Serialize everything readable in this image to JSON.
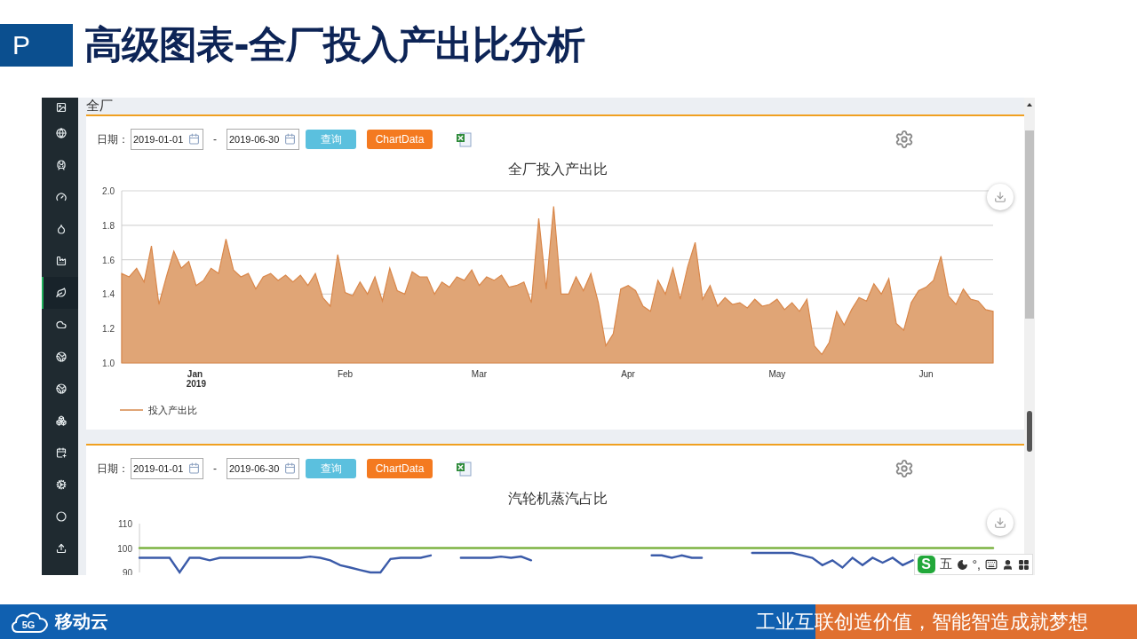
{
  "slide": {
    "badge": "P",
    "title": "高级图表-全厂投入产出比分析"
  },
  "app": {
    "breadcrumb": "全厂",
    "sidebar": {
      "items": [
        {
          "selected": false
        },
        {
          "selected": false
        },
        {
          "selected": false
        },
        {
          "selected": false
        },
        {
          "selected": false
        },
        {
          "selected": false
        },
        {
          "selected": true
        },
        {
          "selected": false
        },
        {
          "selected": false
        },
        {
          "selected": false
        },
        {
          "selected": false
        },
        {
          "selected": false
        },
        {
          "selected": false
        },
        {
          "selected": false
        },
        {
          "selected": false
        }
      ]
    },
    "panels": [
      {
        "date_label": "日期：",
        "start_date": "2019-01-01",
        "separator": "-",
        "end_date": "2019-06-30",
        "buttons": [
          {
            "label": "查询",
            "kind": "query"
          },
          {
            "label": "ChartData",
            "kind": "data"
          }
        ],
        "chart_data": {
          "type": "area",
          "title": "全厂投入产出比",
          "ylim": [
            1,
            2
          ],
          "grid": true,
          "categories": [
            null,
            null,
            null,
            null,
            null,
            null,
            null,
            null,
            null,
            null,
            "Jan 2019",
            null,
            null,
            null,
            null,
            null,
            null,
            null,
            null,
            null,
            null,
            null,
            null,
            null,
            null,
            null,
            null,
            null,
            null,
            null,
            "Feb",
            null,
            null,
            null,
            null,
            null,
            null,
            null,
            null,
            null,
            null,
            null,
            null,
            null,
            null,
            null,
            null,
            null,
            "Mar",
            null,
            null,
            null,
            null,
            null,
            null,
            null,
            null,
            null,
            null,
            null,
            null,
            null,
            null,
            null,
            null,
            null,
            null,
            null,
            "Apr",
            null,
            null,
            null,
            null,
            null,
            null,
            null,
            null,
            null,
            null,
            null,
            null,
            null,
            null,
            null,
            null,
            null,
            null,
            null,
            "May",
            null,
            null,
            null,
            null,
            null,
            null,
            null,
            null,
            null,
            null,
            null,
            null,
            null,
            null,
            null,
            null,
            null,
            null,
            null,
            "Jun",
            null,
            null,
            null,
            null,
            null,
            null,
            null,
            null,
            null
          ],
          "yticks": [
            {
              "value": 1,
              "label": "1.0"
            },
            {
              "value": 1.2,
              "label": "1.2"
            },
            {
              "value": 1.4,
              "label": "1.4"
            },
            {
              "value": 1.6,
              "label": "1.6"
            },
            {
              "value": 1.8,
              "label": "1.8"
            },
            {
              "value": 2,
              "label": "2.0"
            }
          ],
          "series": [
            {
              "name": "投入产出比",
              "color": "#e0a576",
              "values": [
                1.52,
                1.5,
                1.55,
                1.47,
                1.68,
                1.34,
                1.5,
                1.65,
                1.55,
                1.59,
                1.45,
                1.48,
                1.55,
                1.52,
                1.72,
                1.54,
                1.5,
                1.52,
                1.43,
                1.5,
                1.52,
                1.48,
                1.51,
                1.47,
                1.51,
                1.45,
                1.52,
                1.38,
                1.33,
                1.63,
                1.41,
                1.39,
                1.47,
                1.4,
                1.5,
                1.36,
                1.55,
                1.42,
                1.4,
                1.53,
                1.5,
                1.5,
                1.4,
                1.47,
                1.44,
                1.5,
                1.48,
                1.54,
                1.45,
                1.5,
                1.48,
                1.51,
                1.44,
                1.45,
                1.47,
                1.35,
                1.84,
                1.43,
                1.91,
                1.4,
                1.4,
                1.5,
                1.42,
                1.52,
                1.35,
                1.1,
                1.17,
                1.43,
                1.45,
                1.42,
                1.33,
                1.3,
                1.48,
                1.4,
                1.55,
                1.37,
                1.56,
                1.7,
                1.37,
                1.45,
                1.33,
                1.38,
                1.34,
                1.35,
                1.32,
                1.37,
                1.33,
                1.34,
                1.37,
                1.31,
                1.35,
                1.3,
                1.37,
                1.1,
                1.05,
                1.12,
                1.3,
                1.22,
                1.31,
                1.38,
                1.36,
                1.46,
                1.4,
                1.49,
                1.23,
                1.19,
                1.35,
                1.42,
                1.44,
                1.48,
                1.62,
                1.39,
                1.34,
                1.43,
                1.37,
                1.36,
                1.31,
                1.3
              ]
            }
          ]
        }
      },
      {
        "date_label": "日期：",
        "start_date": "2019-01-01",
        "separator": "-",
        "end_date": "2019-06-30",
        "buttons": [
          {
            "label": "查询",
            "kind": "query"
          },
          {
            "label": "ChartData",
            "kind": "data"
          }
        ],
        "chart_data": {
          "type": "line",
          "title": "汽轮机蒸汽占比",
          "ylim": [
            90,
            110
          ],
          "yticks": [
            90,
            100,
            110
          ],
          "series": [
            {
              "color": "#7cb342",
              "values": [
                100,
                100,
                100,
                100,
                100,
                100,
                100,
                100,
                100,
                100,
                100,
                100,
                100,
                100,
                100,
                100,
                100,
                100,
                100,
                100,
                100,
                100,
                100,
                100,
                100,
                100,
                100,
                100,
                100,
                100,
                100,
                100,
                100,
                100,
                100,
                100,
                100,
                100,
                100,
                100,
                100,
                100,
                100,
                100,
                100,
                100,
                100,
                100,
                100,
                100,
                100,
                100,
                100,
                100,
                100,
                100,
                100,
                100,
                100,
                100,
                100,
                100,
                100,
                100,
                100,
                100,
                100,
                100,
                100,
                100,
                100,
                100,
                100,
                100,
                100,
                100,
                100,
                100,
                100,
                100,
                100,
                100,
                100,
                100,
                100,
                100
              ]
            },
            {
              "color": "#3b5ba9",
              "values": [
                96,
                96,
                96,
                96,
                90,
                96,
                96,
                95,
                96,
                96,
                96,
                96,
                96,
                96,
                96,
                96,
                96,
                96.5,
                96,
                95,
                93,
                92,
                91,
                90,
                90,
                95.5,
                96,
                96,
                96,
                97,
                null,
                null,
                96,
                96,
                96,
                96,
                96.5,
                96,
                96.5,
                95,
                null,
                null,
                null,
                null,
                null,
                null,
                null,
                null,
                null,
                null,
                null,
                97,
                97,
                96,
                97,
                96,
                96,
                null,
                null,
                null,
                null,
                98,
                98,
                98,
                98,
                98,
                97,
                96,
                93,
                95,
                92,
                96,
                93,
                96,
                94,
                96,
                93,
                95,
                null,
                null,
                null,
                null,
                null,
                null,
                null,
                null
              ]
            }
          ]
        }
      }
    ]
  },
  "ime_toolbar": {
    "logo": "S",
    "mode": "五",
    "punctuation": "°,"
  },
  "footer": {
    "logo_badge": "5G",
    "logo_text": "移动云",
    "slogan": "工业互联创造价值，智能智造成就梦想"
  }
}
